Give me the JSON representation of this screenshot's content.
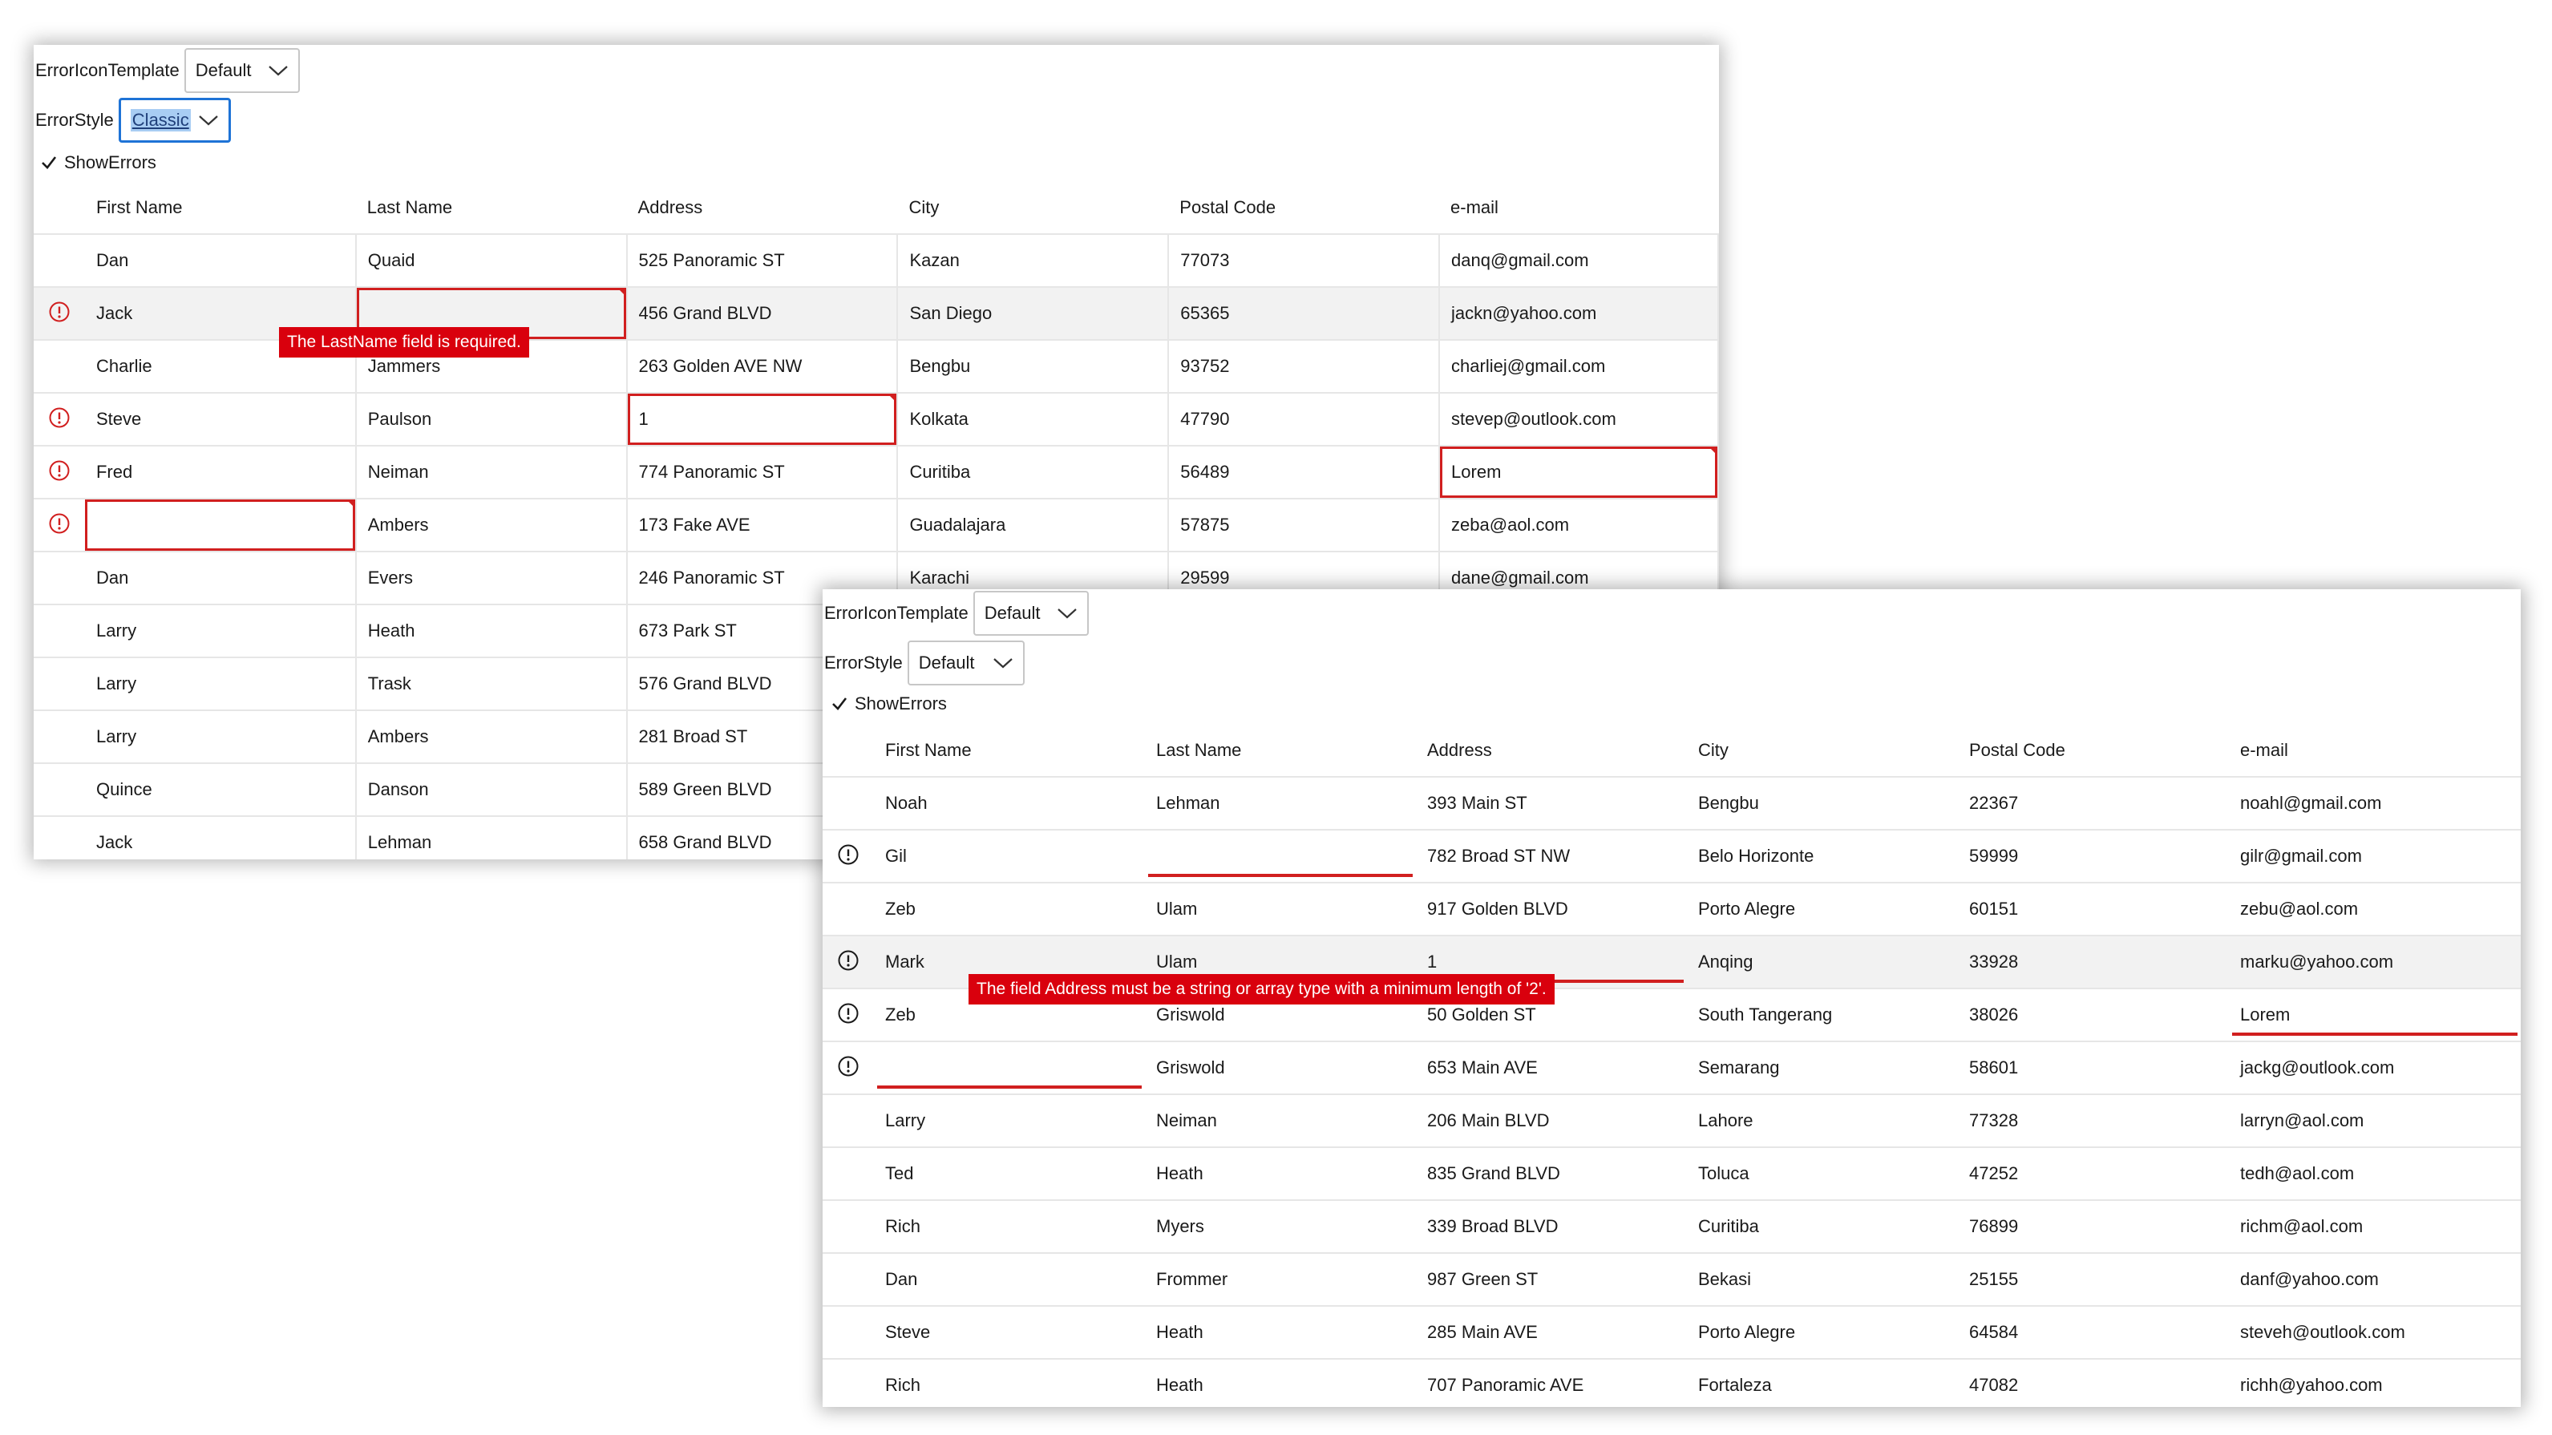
{
  "colors": {
    "error": "#d11f1f",
    "tooltip_bg": "#d9000d",
    "focus": "#1e73d6",
    "selection": "#a8cdf3"
  },
  "icons": {
    "row_error": "exclamation-circle-icon",
    "dropdown": "chevron-down-icon",
    "check": "checkmark-icon"
  },
  "window1": {
    "error_icon_template": {
      "label": "ErrorIconTemplate",
      "value": "Default"
    },
    "error_style": {
      "label": "ErrorStyle",
      "value": "Classic"
    },
    "show_errors": {
      "label": "ShowErrors",
      "checked": true
    },
    "columns": [
      "First Name",
      "Last Name",
      "Address",
      "City",
      "Postal Code",
      "e-mail"
    ],
    "tooltip": "The LastName field is required.",
    "rows": [
      {
        "error": false,
        "cells": [
          "Dan",
          "Quaid",
          "525 Panoramic ST",
          "Kazan",
          "77073",
          "danq@gmail.com"
        ]
      },
      {
        "error": true,
        "cells": [
          "Jack",
          "",
          "456 Grand BLVD",
          "San Diego",
          "65365",
          "jackn@yahoo.com"
        ]
      },
      {
        "error": false,
        "cells": [
          "Charlie",
          "Jammers",
          "263 Golden AVE NW",
          "Bengbu",
          "93752",
          "charliej@gmail.com"
        ]
      },
      {
        "error": true,
        "cells": [
          "Steve",
          "Paulson",
          "1",
          "Kolkata",
          "47790",
          "stevep@outlook.com"
        ]
      },
      {
        "error": true,
        "cells": [
          "Fred",
          "Neiman",
          "774 Panoramic ST",
          "Curitiba",
          "56489",
          "Lorem"
        ]
      },
      {
        "error": true,
        "cells": [
          "",
          "Ambers",
          "173 Fake AVE",
          "Guadalajara",
          "57875",
          "zeba@aol.com"
        ]
      },
      {
        "error": false,
        "cells": [
          "Dan",
          "Evers",
          "246 Panoramic ST",
          "Karachi",
          "29599",
          "dane@gmail.com"
        ]
      },
      {
        "error": false,
        "cells": [
          "Larry",
          "Heath",
          "673 Park ST",
          "",
          "",
          ""
        ]
      },
      {
        "error": false,
        "cells": [
          "Larry",
          "Trask",
          "576 Grand BLVD",
          "",
          "",
          ""
        ]
      },
      {
        "error": false,
        "cells": [
          "Larry",
          "Ambers",
          "281 Broad ST",
          "",
          "",
          ""
        ]
      },
      {
        "error": false,
        "cells": [
          "Quince",
          "Danson",
          "589 Green BLVD",
          "",
          "",
          ""
        ]
      },
      {
        "error": false,
        "cells": [
          "Jack",
          "Lehman",
          "658 Grand BLVD",
          "",
          "",
          ""
        ]
      }
    ]
  },
  "window2": {
    "error_icon_template": {
      "label": "ErrorIconTemplate",
      "value": "Default"
    },
    "error_style": {
      "label": "ErrorStyle",
      "value": "Default"
    },
    "show_errors": {
      "label": "ShowErrors",
      "checked": true
    },
    "columns": [
      "First Name",
      "Last Name",
      "Address",
      "City",
      "Postal Code",
      "e-mail"
    ],
    "tooltip": "The field Address must be a string or array type with a minimum length of '2'.",
    "rows": [
      {
        "error": false,
        "cells": [
          "Noah",
          "Lehman",
          "393 Main ST",
          "Bengbu",
          "22367",
          "noahl@gmail.com"
        ]
      },
      {
        "error": true,
        "cells": [
          "Gil",
          "",
          "782 Broad ST NW",
          "Belo Horizonte",
          "59999",
          "gilr@gmail.com"
        ]
      },
      {
        "error": false,
        "cells": [
          "Zeb",
          "Ulam",
          "917 Golden BLVD",
          "Porto Alegre",
          "60151",
          "zebu@aol.com"
        ]
      },
      {
        "error": true,
        "cells": [
          "Mark",
          "Ulam",
          "1",
          "Anqing",
          "33928",
          "marku@yahoo.com"
        ]
      },
      {
        "error": true,
        "cells": [
          "Zeb",
          "Griswold",
          "50 Golden ST",
          "South Tangerang",
          "38026",
          "Lorem"
        ]
      },
      {
        "error": true,
        "cells": [
          "",
          "Griswold",
          "653 Main AVE",
          "Semarang",
          "58601",
          "jackg@outlook.com"
        ]
      },
      {
        "error": false,
        "cells": [
          "Larry",
          "Neiman",
          "206 Main BLVD",
          "Lahore",
          "77328",
          "larryn@aol.com"
        ]
      },
      {
        "error": false,
        "cells": [
          "Ted",
          "Heath",
          "835 Grand BLVD",
          "Toluca",
          "47252",
          "tedh@aol.com"
        ]
      },
      {
        "error": false,
        "cells": [
          "Rich",
          "Myers",
          "339 Broad BLVD",
          "Curitiba",
          "76899",
          "richm@aol.com"
        ]
      },
      {
        "error": false,
        "cells": [
          "Dan",
          "Frommer",
          "987 Green ST",
          "Bekasi",
          "25155",
          "danf@yahoo.com"
        ]
      },
      {
        "error": false,
        "cells": [
          "Steve",
          "Heath",
          "285 Main AVE",
          "Porto Alegre",
          "64584",
          "steveh@outlook.com"
        ]
      },
      {
        "error": false,
        "cells": [
          "Rich",
          "Heath",
          "707 Panoramic AVE",
          "Fortaleza",
          "47082",
          "richh@yahoo.com"
        ]
      }
    ]
  }
}
